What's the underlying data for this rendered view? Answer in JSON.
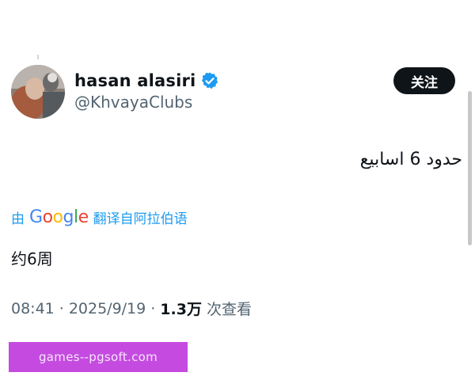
{
  "author": {
    "display_name": "hasan alasiri",
    "handle": "@KhvayaClubs",
    "verified_icon": "verified-badge-icon",
    "avatar": "avatar-photo"
  },
  "follow_button": {
    "label": "关注"
  },
  "tweet": {
    "text": "حدود 6 اسابيع"
  },
  "translation": {
    "prefix": "由",
    "brand": [
      "G",
      "o",
      "o",
      "g",
      "l",
      "e"
    ],
    "brand_colors": [
      "#4285F4",
      "#EA4335",
      "#FBBC05",
      "#4285F4",
      "#34A853",
      "#EA4335"
    ],
    "suffix": "翻译自阿拉伯语",
    "translated_text": "约6周"
  },
  "meta": {
    "time": "08:41",
    "separator": "·",
    "date": "2025/9/19",
    "views_count": "1.3万",
    "views_label": "次查看"
  },
  "watermark": {
    "text": "games--pgsoft.com"
  },
  "colors": {
    "accent": "#1d9bf0",
    "text": "#0f1419",
    "secondary": "#536471",
    "watermark_bg": "#c54be0"
  }
}
